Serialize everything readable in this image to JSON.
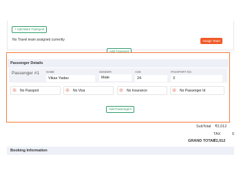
{
  "transport": {
    "add_button": "+ Add More Transport",
    "note": "No Travel team assigned currently",
    "assign_button": "Assign Team",
    "add_button_faint": "Add Transport"
  },
  "passenger_details": {
    "title": "Passenger Details",
    "passenger_label": "Passenger #1",
    "columns": {
      "name": "NAME",
      "gender": "GENDER",
      "age": "AGE",
      "passport": "PASSPORT NO."
    },
    "values": {
      "name": "Vikas Yadav",
      "gender": "Male",
      "age": "24",
      "passport": "3"
    },
    "documents": [
      {
        "icon": "x",
        "label": "No Passport"
      },
      {
        "icon": "x",
        "label": "No Visa"
      },
      {
        "icon": "x",
        "label": "No Insurance"
      },
      {
        "icon": "x",
        "label": "No Passenger Id"
      }
    ],
    "add_button": "Add Passengers"
  },
  "totals": {
    "subtotal_label": "SubTotal",
    "subtotal_value": "₹2,012",
    "tax_label": "TAX",
    "tax_value": "0",
    "grand_label": "GRAND TOTAL",
    "grand_value": "₹2,012"
  },
  "booking": {
    "title": "Booking Information"
  },
  "colors": {
    "accent_orange": "#f47a3a",
    "assign_button": "#f05a28",
    "green": "#2e9c6a"
  }
}
